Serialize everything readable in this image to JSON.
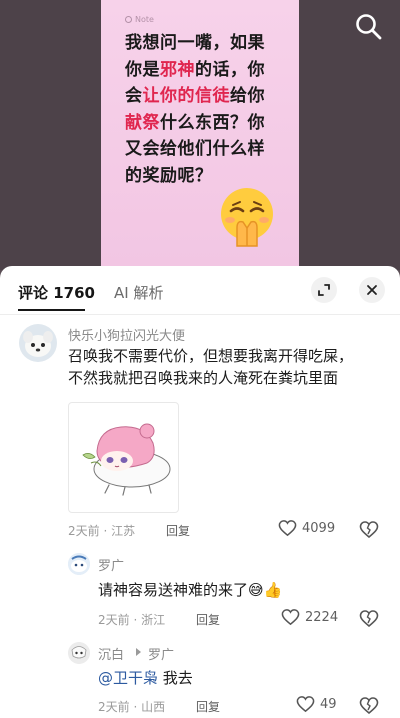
{
  "post": {
    "note_tag": "Note",
    "lines": [
      {
        "parts": [
          {
            "t": "我想问一嘴，如果",
            "hl": false
          }
        ]
      },
      {
        "parts": [
          {
            "t": "你是",
            "hl": false
          },
          {
            "t": "邪神",
            "hl": true
          },
          {
            "t": "的话，你",
            "hl": false
          }
        ]
      },
      {
        "parts": [
          {
            "t": "会",
            "hl": false
          },
          {
            "t": "让你的信徒",
            "hl": true
          },
          {
            "t": "给你",
            "hl": false
          }
        ]
      },
      {
        "parts": [
          {
            "t": "献祭",
            "hl": true
          },
          {
            "t": "什么东西？你",
            "hl": false
          }
        ]
      },
      {
        "parts": [
          {
            "t": "又会给他们什么样",
            "hl": false
          }
        ]
      },
      {
        "parts": [
          {
            "t": "的奖励呢？",
            "hl": false
          }
        ]
      }
    ],
    "emoji": "pleading-hands-emoji",
    "highlight_color": "#e0264f",
    "card_color": "#f7d2ea"
  },
  "sheet": {
    "tab_comments": "评论 1760",
    "tab_ai": "AI 解析"
  },
  "comments": [
    {
      "user": "快乐小狗拉闪光大便",
      "text_line1": "召唤我不需要代价，但想要我离开得吃屎，",
      "text_line2": "不然我就把召唤我来的人淹死在粪坑里面",
      "meta": "2天前 · 江苏",
      "reply": "回复",
      "likes": "4099",
      "sticker": "anime-pink-hair-girl-sticker"
    },
    {
      "user": "罗广",
      "text": "请神容易送神难的来了",
      "emojis": "😅👍",
      "meta": "2天前 · 浙江",
      "reply": "回复",
      "likes": "2224"
    },
    {
      "user": "沉白",
      "reply_to": "罗广",
      "mention": "@卫干枭",
      "text": " 我去",
      "meta": "2天前 · 山西",
      "reply": "回复",
      "likes": "49"
    }
  ]
}
